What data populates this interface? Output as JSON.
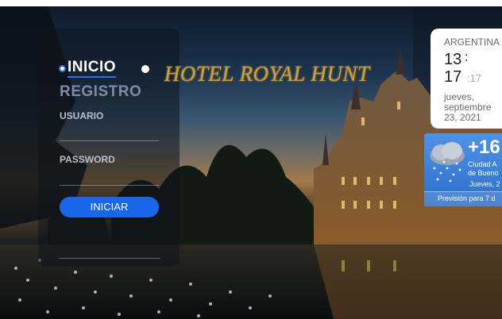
{
  "nav": {
    "inicio": "INICIO",
    "registro": "REGISTRO"
  },
  "hotel": {
    "title": "HOTEL ROYAL HUNT"
  },
  "login": {
    "usuario_label": "USUARIO",
    "usuario_value": "",
    "password_label": "PASSWORD",
    "password_value": "",
    "submit_label": "INICIAR"
  },
  "clock": {
    "country": "ARGENTINA",
    "hour": "13",
    "colon": ":",
    "minute": "17",
    "seconds": ":17",
    "date": "jueves, septiembre 23, 2021"
  },
  "weather": {
    "temperature": "+16",
    "city_line1": "Ciudad A",
    "city_line2": "de Bueno",
    "day": "Jueves, 2",
    "forecast_label": "Previsión para 7 d",
    "icon": "cloud-rain-icon"
  },
  "colors": {
    "accent": "#1a66e8",
    "title_gold": "#c9a23c",
    "nav_inactive": "#7f8aa6"
  }
}
